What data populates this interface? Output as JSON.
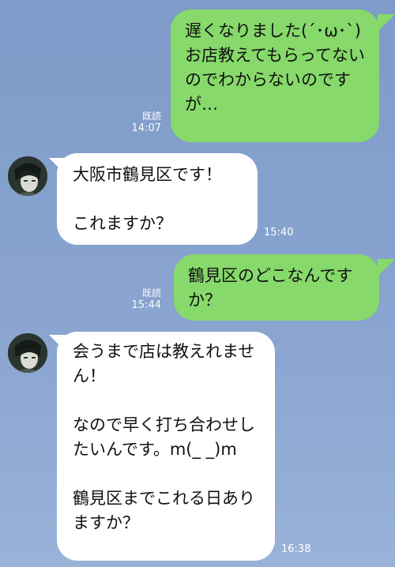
{
  "messages": [
    {
      "side": "out",
      "text": "遅くなりました(´･ω･`)\nお店教えてもらってないのでわからないのですが…",
      "read": "既読",
      "time": "14:07"
    },
    {
      "side": "in",
      "text": "大阪市鶴見区です！\n\nこれますか？",
      "time": "15:40"
    },
    {
      "side": "out",
      "text": "鶴見区のどこなんですか？",
      "read": "既読",
      "time": "15:44"
    },
    {
      "side": "in",
      "text": "会うまで店は教えれません！\n\nなので早く打ち合わせしたいんです。m(_ _)m\n\n鶴見区までこれる日ありますか？",
      "time": "16:38"
    }
  ],
  "colors": {
    "out_bubble": "#86d96a",
    "in_bubble": "#ffffff",
    "background": "#8aa5d0"
  },
  "icons": {
    "avatar": "contact-avatar"
  }
}
